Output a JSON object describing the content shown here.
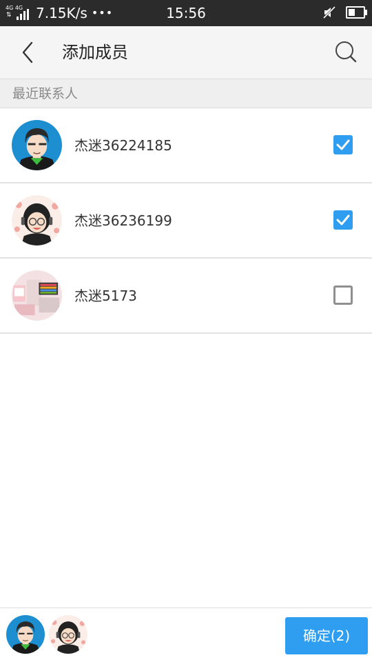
{
  "status_bar": {
    "network_label": "4G 4G",
    "net_speed": "7.15K/s",
    "overflow_dots": "•••",
    "time": "15:56",
    "icons": [
      "signal-icon",
      "mute-icon",
      "battery-icon"
    ],
    "battery_level": 0.55
  },
  "header": {
    "back_icon": "chevron-left-icon",
    "title": "添加成员",
    "search_icon": "search-icon"
  },
  "section": {
    "title": "最近联系人"
  },
  "contacts": [
    {
      "name": "杰迷36224185",
      "avatar": "boy-cartoon-avatar",
      "checked": true
    },
    {
      "name": "杰迷36236199",
      "avatar": "girl-cartoon-avatar",
      "checked": true
    },
    {
      "name": "杰迷5173",
      "avatar": "photo-avatar",
      "checked": false
    }
  ],
  "bottom_bar": {
    "selected_avatars": [
      "boy-cartoon-avatar",
      "girl-cartoon-avatar"
    ],
    "confirm_label": "确定(2)"
  },
  "colors": {
    "accent": "#2f9ef0",
    "status_bar_bg": "#2b2b2b",
    "header_bg": "#f5f5f5",
    "section_bg": "#efefef"
  }
}
